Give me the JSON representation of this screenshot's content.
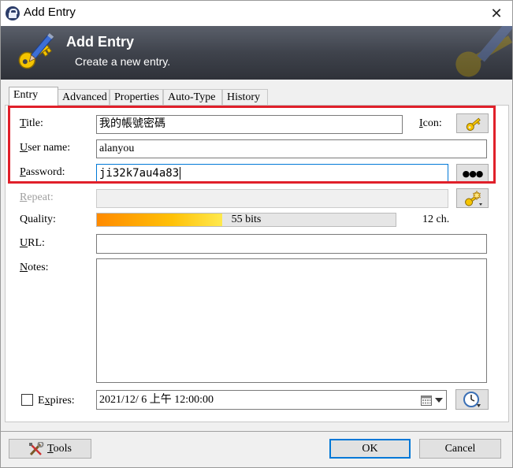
{
  "window": {
    "title": "Add Entry",
    "close_glyph": "✕"
  },
  "banner": {
    "title": "Add Entry",
    "subtitle": "Create a new entry.",
    "icon": "key-icon"
  },
  "tabs": [
    {
      "label": "Entry",
      "active": true
    },
    {
      "label": "Advanced",
      "active": false
    },
    {
      "label": "Properties",
      "active": false
    },
    {
      "label": "Auto-Type",
      "active": false
    },
    {
      "label": "History",
      "active": false
    }
  ],
  "form": {
    "title_label_hot": "T",
    "title_label_rest": "itle:",
    "title_value": "我的帳號密碼",
    "icon_label_hot": "I",
    "icon_label_rest": "con:",
    "username_label_hot": "U",
    "username_label_rest": "ser name:",
    "username_value": "alanyou",
    "password_label_hot": "P",
    "password_label_rest": "assword:",
    "password_value": "ji32k7au4a83",
    "reveal_glyph": "●●●",
    "repeat_label_hot": "R",
    "repeat_label_rest": "epeat:",
    "repeat_value": "",
    "quality_label": "Quality:",
    "quality_fraction": 0.42,
    "quality_text": "55 bits",
    "quality_chars": "12 ch.",
    "url_label_hot": "U",
    "url_label_rest": "RL:",
    "url_value": "",
    "notes_label_hot": "N",
    "notes_label_rest": "otes:",
    "notes_value": "",
    "expires_label_hot": "x",
    "expires_label_pre": "E",
    "expires_label_rest": "pires:",
    "expires_checked": false,
    "expiry_value": "2021/12/  6 上午 12:00:00"
  },
  "footer": {
    "tools_label_hot": "T",
    "tools_label_rest": "ools",
    "ok_label": "OK",
    "cancel_label": "Cancel"
  },
  "colors": {
    "highlight": "#e0202a",
    "focus": "#0078d7",
    "banner_dark": "#2f3239"
  }
}
